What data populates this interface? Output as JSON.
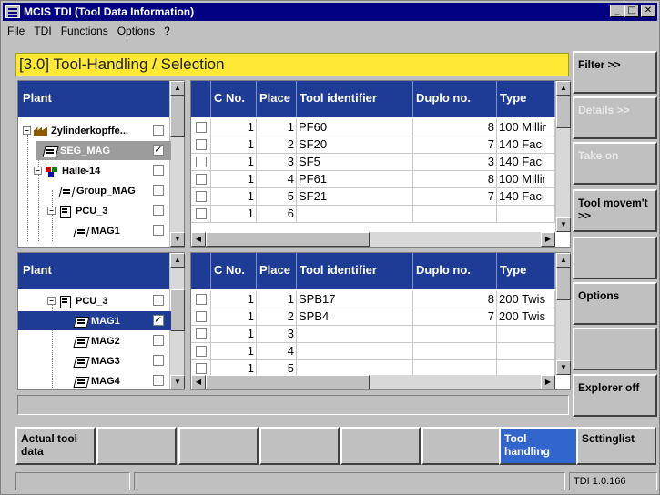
{
  "window": {
    "title": "MCIS TDI (Tool Data Information)",
    "minimize": "_",
    "maximize": "□",
    "close": "✕"
  },
  "menu": [
    "File",
    "TDI",
    "Functions",
    "Options",
    "?"
  ],
  "header": {
    "title": "[3.0] Tool-Handling / Selection"
  },
  "right_softkeys": [
    {
      "label": "Filter >>",
      "enabled": true
    },
    {
      "label": "Details >>",
      "enabled": false
    },
    {
      "label": "Take on",
      "enabled": false
    },
    {
      "label": "Tool movem't >>",
      "enabled": true
    },
    {
      "label": "",
      "enabled": true
    },
    {
      "label": "Options",
      "enabled": true
    },
    {
      "label": "",
      "enabled": true
    },
    {
      "label": "Explorer off",
      "enabled": true
    }
  ],
  "bottom_softkeys": [
    {
      "label": "Actual tool data",
      "active": false
    },
    {
      "label": "",
      "active": false
    },
    {
      "label": "",
      "active": false
    },
    {
      "label": "",
      "active": false
    },
    {
      "label": "",
      "active": false
    },
    {
      "label": "",
      "active": false
    },
    {
      "label": "Tool handling",
      "active": true
    },
    {
      "label": "Settinglist",
      "active": false
    }
  ],
  "tree_top": {
    "header": "Plant",
    "rows": [
      {
        "label": "Zylinderkopffe...",
        "icon": "factory-icon",
        "checked": false
      },
      {
        "label": "SEG_MAG",
        "icon": "magazine-icon",
        "checked": true
      },
      {
        "label": "Halle-14",
        "icon": "hall-icon",
        "checked": false
      },
      {
        "label": "Group_MAG",
        "icon": "magazine-icon",
        "checked": false
      },
      {
        "label": "PCU_3",
        "icon": "pcu-icon",
        "checked": false
      },
      {
        "label": "MAG1",
        "icon": "magazine-icon",
        "checked": false
      }
    ]
  },
  "tree_bottom": {
    "header": "Plant",
    "rows": [
      {
        "label": "PCU_3",
        "icon": "pcu-icon",
        "checked": false
      },
      {
        "label": "MAG1",
        "icon": "magazine-icon",
        "checked": true
      },
      {
        "label": "MAG2",
        "icon": "magazine-icon",
        "checked": false
      },
      {
        "label": "MAG3",
        "icon": "magazine-icon",
        "checked": false
      },
      {
        "label": "MAG4",
        "icon": "magazine-icon",
        "checked": false
      }
    ]
  },
  "columns": [
    "C No.",
    "Place",
    "Tool identifier",
    "Duplo no.",
    "Type"
  ],
  "table_top": [
    {
      "cno": "1",
      "place": "1",
      "tool": "PF60",
      "duplo": "8",
      "type": "100 Millir"
    },
    {
      "cno": "1",
      "place": "2",
      "tool": "SF20",
      "duplo": "7",
      "type": "140 Faci"
    },
    {
      "cno": "1",
      "place": "3",
      "tool": "SF5",
      "duplo": "3",
      "type": "140 Faci"
    },
    {
      "cno": "1",
      "place": "4",
      "tool": "PF61",
      "duplo": "8",
      "type": "100 Millir"
    },
    {
      "cno": "1",
      "place": "5",
      "tool": "SF21",
      "duplo": "7",
      "type": "140 Faci"
    },
    {
      "cno": "1",
      "place": "6",
      "tool": "",
      "duplo": "",
      "type": ""
    }
  ],
  "table_bottom": [
    {
      "cno": "1",
      "place": "1",
      "tool": "SPB17",
      "duplo": "8",
      "type": "200 Twis"
    },
    {
      "cno": "1",
      "place": "2",
      "tool": "SPB4",
      "duplo": "7",
      "type": "200 Twis"
    },
    {
      "cno": "1",
      "place": "3",
      "tool": "",
      "duplo": "",
      "type": ""
    },
    {
      "cno": "1",
      "place": "4",
      "tool": "",
      "duplo": "",
      "type": ""
    },
    {
      "cno": "1",
      "place": "5",
      "tool": "",
      "duplo": "",
      "type": ""
    }
  ],
  "status": {
    "version": "TDI 1.0.166"
  },
  "colors": {
    "accent": "#1e3c96",
    "header": "#ffe935",
    "active_key": "#3366cc"
  }
}
